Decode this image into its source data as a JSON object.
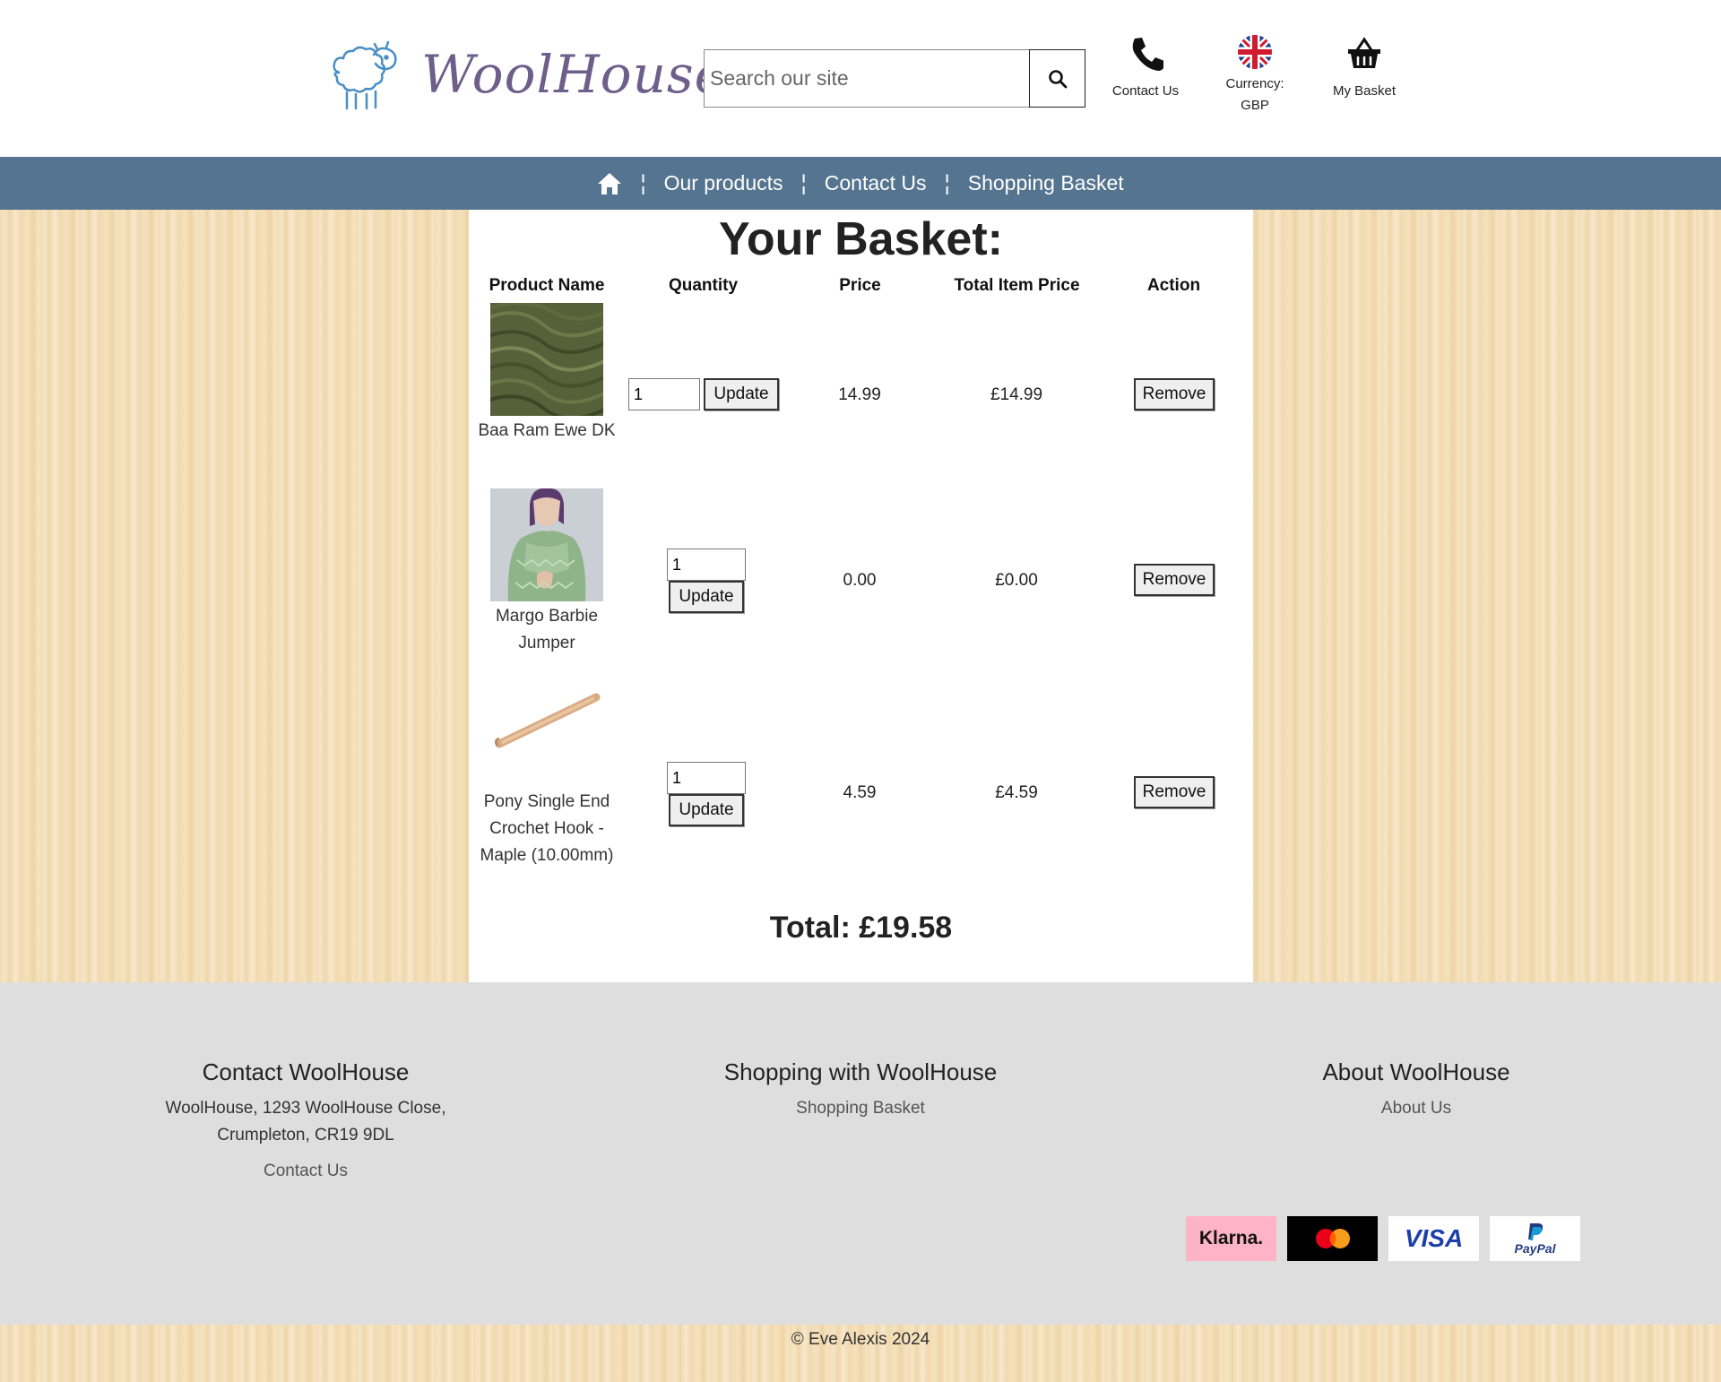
{
  "header": {
    "logo_text": "WoolHouse",
    "search_placeholder": "Search our site",
    "contact_label": "Contact Us",
    "currency_label": "Currency:",
    "currency_value": "GBP",
    "basket_label": "My Basket"
  },
  "nav": {
    "items": [
      "Our products",
      "Contact Us",
      "Shopping Basket"
    ]
  },
  "basket": {
    "title": "Your Basket:",
    "columns": [
      "Product Name",
      "Quantity",
      "Price",
      "Total Item Price",
      "Action"
    ],
    "update_label": "Update",
    "remove_label": "Remove",
    "rows": [
      {
        "name": "Baa Ram Ewe DK",
        "quantity": "1",
        "price": "14.99",
        "total": "£14.99"
      },
      {
        "name": "Margo Barbie Jumper",
        "quantity": "1",
        "price": "0.00",
        "total": "£0.00"
      },
      {
        "name": "Pony Single End Crochet Hook - Maple (10.00mm)",
        "quantity": "1",
        "price": "4.59",
        "total": "£4.59"
      }
    ],
    "total": "Total: £19.58"
  },
  "footer": {
    "contact_title": "Contact WoolHouse",
    "address_line1": "WoolHouse, 1293 WoolHouse Close,",
    "address_line2": "Crumpleton, CR19 9DL",
    "contact_link": "Contact Us",
    "shopping_title": "Shopping with WoolHouse",
    "shopping_link": "Shopping Basket",
    "about_title": "About WoolHouse",
    "about_link": "About Us",
    "payments": [
      "Klarna.",
      "VISA",
      "PayPal"
    ],
    "copyright": "© Eve Alexis 2024"
  },
  "colors": {
    "nav_bg": "#55748f",
    "footer_bg": "#dedede",
    "logo": "#6e5f8a",
    "sheep": "#4a8fc4"
  },
  "icons": [
    "sheep-logo-icon",
    "search-icon",
    "phone-icon",
    "uk-flag-icon",
    "basket-icon",
    "home-icon"
  ]
}
